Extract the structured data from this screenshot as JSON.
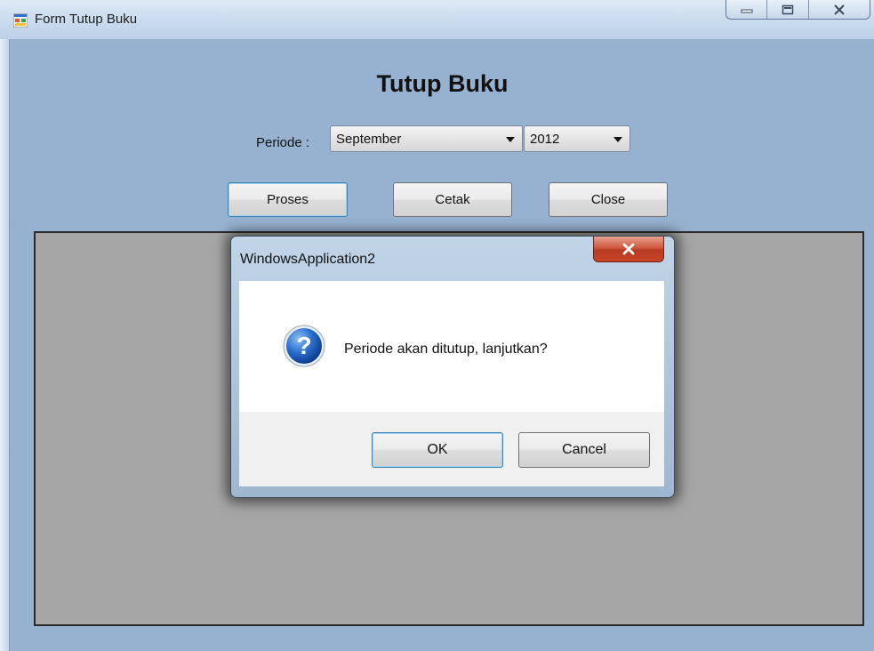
{
  "window": {
    "title": "Form Tutup Buku",
    "controls": [
      "minimize-icon",
      "maximize-icon",
      "close-icon"
    ]
  },
  "form": {
    "heading": "Tutup Buku",
    "periode_label": "Periode :",
    "month": {
      "selected": "September"
    },
    "year": {
      "selected": "2012"
    },
    "buttons": {
      "proses": "Proses",
      "cetak": "Cetak",
      "close": "Close"
    }
  },
  "dialog": {
    "title": "WindowsApplication2",
    "icon": "question-icon",
    "message": "Periode akan ditutup, lanjutkan?",
    "ok_label": "OK",
    "cancel_label": "Cancel"
  },
  "colors": {
    "client_bg": "#97b2d1",
    "panel_bg": "#a6a6a6",
    "dialog_close_red": "#c9452a",
    "focus_blue": "#3c7fb1"
  }
}
